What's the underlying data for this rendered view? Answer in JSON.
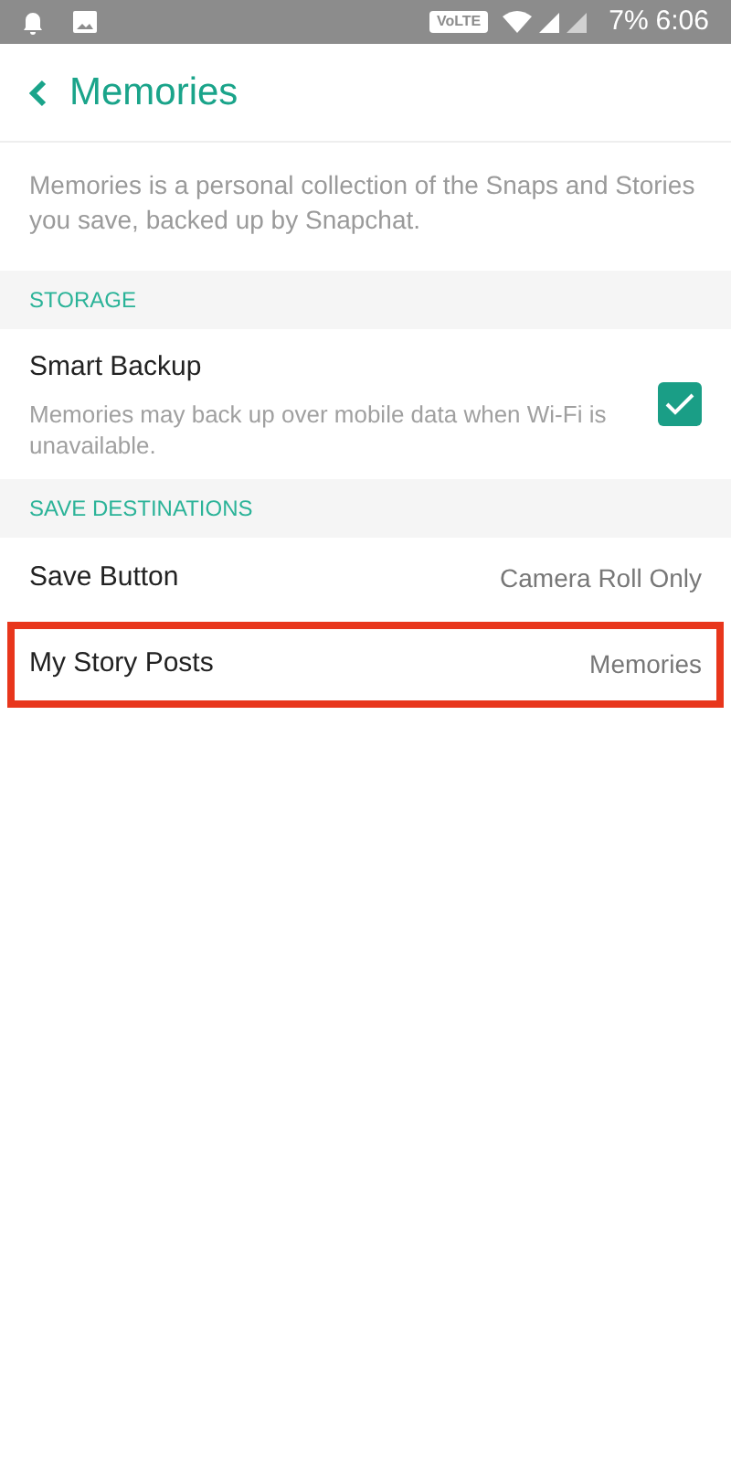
{
  "status_bar": {
    "badge": "VoLTE",
    "battery": "7%",
    "time": "6:06"
  },
  "header": {
    "title": "Memories"
  },
  "description": "Memories is a personal collection of the Snaps and Stories you save, backed up by Snapchat.",
  "sections": [
    {
      "title": "STORAGE",
      "items": [
        {
          "kind": "checkbox",
          "label": "Smart Backup",
          "subtitle": "Memories may back up over mobile data when Wi-Fi is unavailable.",
          "checked": true,
          "highlighted": false
        }
      ]
    },
    {
      "title": "SAVE DESTINATIONS",
      "items": [
        {
          "kind": "value",
          "label": "Save Button",
          "value": "Camera Roll Only",
          "highlighted": false
        },
        {
          "kind": "value",
          "label": "My Story Posts",
          "value": "Memories",
          "highlighted": true
        }
      ]
    }
  ]
}
